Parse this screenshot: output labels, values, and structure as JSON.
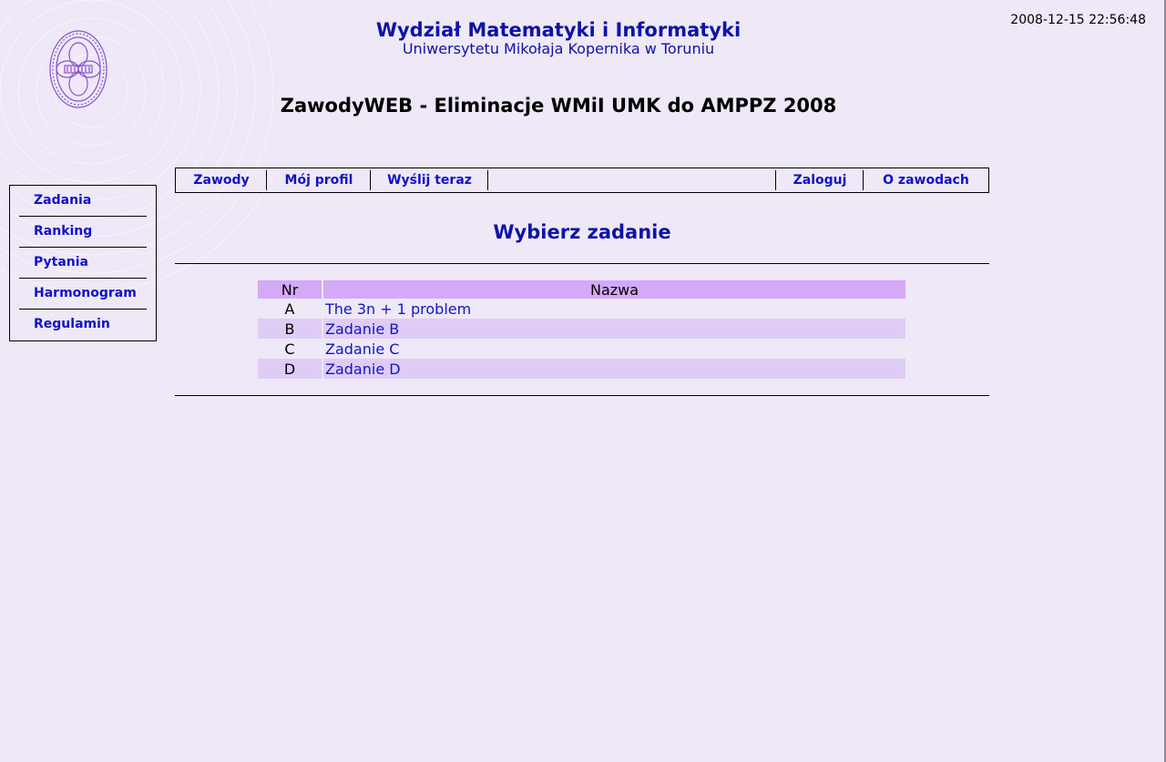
{
  "header": {
    "timestamp": "2008-12-15 22:56:48",
    "dept_title": "Wydział Matematyki i Informatyki",
    "dept_subtitle": "Uniwersytetu Mikołaja Kopernika w Toruniu",
    "contest_title": "ZawodyWEB - Eliminacje WMiI UMK do AMPPZ 2008",
    "logo_icon": "umk-seal-icon"
  },
  "topnav": {
    "left": [
      {
        "label": "Zawody"
      },
      {
        "label": "Mój profil"
      },
      {
        "label": "Wyślij teraz"
      }
    ],
    "right": [
      {
        "label": "Zaloguj"
      },
      {
        "label": "O zawodach"
      }
    ]
  },
  "sidebar": {
    "items": [
      {
        "label": "Zadania"
      },
      {
        "label": "Ranking"
      },
      {
        "label": "Pytania"
      },
      {
        "label": "Harmonogram"
      },
      {
        "label": "Regulamin"
      }
    ]
  },
  "main": {
    "heading": "Wybierz zadanie",
    "table": {
      "columns": [
        "Nr",
        "Nazwa"
      ],
      "rows": [
        {
          "nr": "A",
          "name": "The 3n + 1 problem"
        },
        {
          "nr": "B",
          "name": "Zadanie B"
        },
        {
          "nr": "C",
          "name": "Zadanie C"
        },
        {
          "nr": "D",
          "name": "Zadanie D"
        }
      ]
    }
  },
  "colors": {
    "background": "#eee8f7",
    "link": "#0f12c8",
    "header_row": "#d4a9f8",
    "alt_row": "#dfccf5"
  }
}
